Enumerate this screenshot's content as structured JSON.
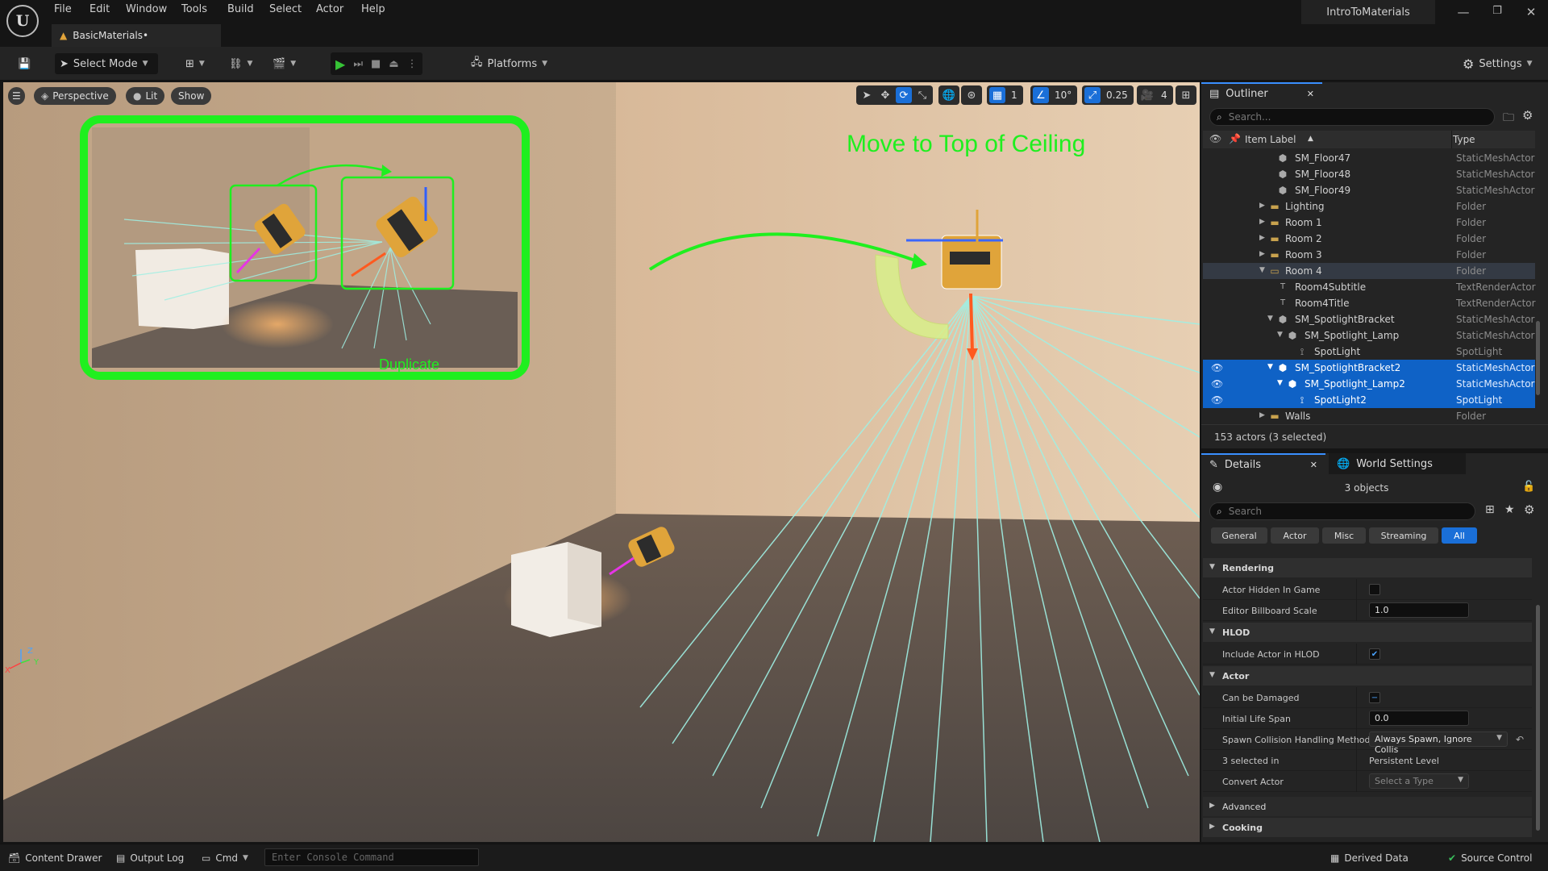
{
  "menu": [
    "File",
    "Edit",
    "Window",
    "Tools",
    "Build",
    "Select",
    "Actor",
    "Help"
  ],
  "project_title": "IntroToMaterials",
  "doc_tab": "BasicMaterials•",
  "toolbar": {
    "select_mode": "Select Mode",
    "platforms": "Platforms",
    "settings": "Settings"
  },
  "viewport": {
    "perspective": "Perspective",
    "lit": "Lit",
    "show": "Show",
    "grid_value": "1",
    "angle_value": "10°",
    "scale_value": "0.25",
    "camera_speed": "4",
    "annotation_title": "Move to Top of Ceiling",
    "annotation_duplicate": "Duplicate",
    "axis_z": "Z",
    "axis_y": "Y",
    "axis_x": "X",
    "colors": {
      "annotation": "#1fef1f",
      "spot_lines": "#9ff0e4",
      "select": "#0f62c6"
    }
  },
  "outliner": {
    "tab": "Outliner",
    "search_placeholder": "Search...",
    "col_label": "Item Label",
    "col_type": "Type",
    "rows": [
      {
        "label": "SM_Floor47",
        "type": "StaticMeshActor",
        "icon": "mesh"
      },
      {
        "label": "SM_Floor48",
        "type": "StaticMeshActor",
        "icon": "mesh"
      },
      {
        "label": "SM_Floor49",
        "type": "StaticMeshActor",
        "icon": "mesh"
      },
      {
        "label": "Lighting",
        "type": "Folder",
        "icon": "folder"
      },
      {
        "label": "Room 1",
        "type": "Folder",
        "icon": "folder"
      },
      {
        "label": "Room 2",
        "type": "Folder",
        "icon": "folder"
      },
      {
        "label": "Room 3",
        "type": "Folder",
        "icon": "folder"
      },
      {
        "label": "Room 4",
        "type": "Folder",
        "icon": "folder-open"
      },
      {
        "label": "Room4Subtitle",
        "type": "TextRenderActor",
        "icon": "text"
      },
      {
        "label": "Room4Title",
        "type": "TextRenderActor",
        "icon": "text"
      },
      {
        "label": "SM_SpotlightBracket",
        "type": "StaticMeshActor",
        "icon": "mesh"
      },
      {
        "label": "SM_Spotlight_Lamp",
        "type": "StaticMeshActor",
        "icon": "mesh"
      },
      {
        "label": "SpotLight",
        "type": "SpotLight",
        "icon": "spotlight"
      },
      {
        "label": "SM_SpotlightBracket2",
        "type": "StaticMeshActor",
        "icon": "mesh"
      },
      {
        "label": "SM_Spotlight_Lamp2",
        "type": "StaticMeshActor",
        "icon": "mesh"
      },
      {
        "label": "SpotLight2",
        "type": "SpotLight",
        "icon": "spotlight"
      },
      {
        "label": "Walls",
        "type": "Folder",
        "icon": "folder"
      }
    ],
    "footer": "153 actors (3 selected)"
  },
  "details": {
    "tab": "Details",
    "world_tab": "World Settings",
    "objects": "3 objects",
    "search_placeholder": "Search",
    "categories": [
      "General",
      "Actor",
      "Misc",
      "Streaming",
      "All"
    ],
    "sections": {
      "rendering": "Rendering",
      "hlod": "HLOD",
      "actor": "Actor",
      "advanced": "Advanced",
      "cooking": "Cooking"
    },
    "props": {
      "hidden": "Actor Hidden In Game",
      "billboard": "Editor Billboard Scale",
      "billboard_val": "1.0",
      "include_hlod": "Include Actor in HLOD",
      "damaged": "Can be Damaged",
      "lifespan": "Initial Life Span",
      "lifespan_val": "0.0",
      "spawn": "Spawn Collision Handling Method",
      "spawn_val": "Always Spawn, Ignore Collis",
      "selected_in": "3 selected in",
      "level": "Persistent Level",
      "convert": "Convert Actor",
      "convert_val": "Select a Type"
    }
  },
  "status": {
    "content_drawer": "Content Drawer",
    "output_log": "Output Log",
    "cmd": "Cmd",
    "console_placeholder": "Enter Console Command",
    "derived": "Derived Data",
    "source": "Source Control"
  }
}
